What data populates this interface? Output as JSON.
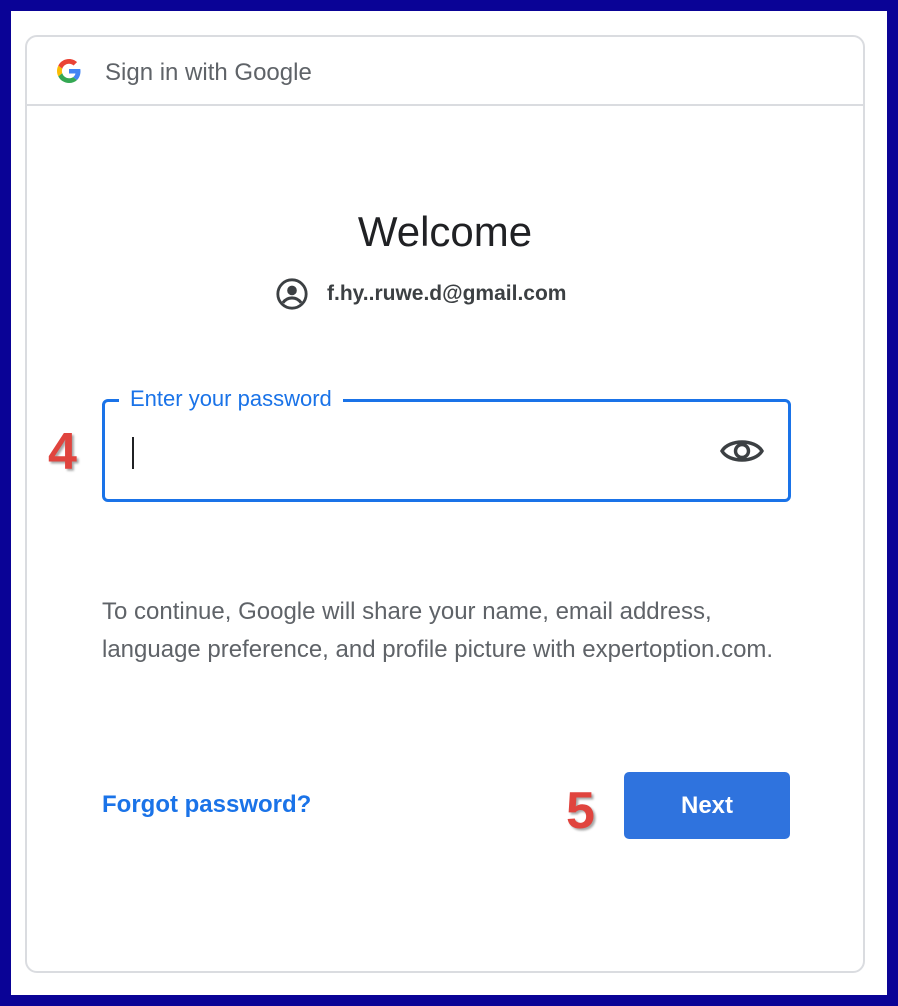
{
  "header": {
    "logo_icon": "google-g-icon",
    "title": "Sign in with Google"
  },
  "main": {
    "heading": "Welcome",
    "account": {
      "icon": "account-circle-icon",
      "email": "f.hy..ruwe.d@gmail.com"
    },
    "password_field": {
      "label": "Enter your password",
      "value": "",
      "toggle_icon": "eye-icon"
    },
    "consent_text": "To continue, Google will share your name, email address, language preference, and profile picture with expertoption.com.",
    "forgot_link": "Forgot password?",
    "next_button": "Next"
  },
  "annotations": {
    "marker_password": "4",
    "marker_next": "5"
  },
  "colors": {
    "frame": "#0a0396",
    "accent": "#1a73e8",
    "button": "#2f73de",
    "marker": "#e0443e"
  }
}
